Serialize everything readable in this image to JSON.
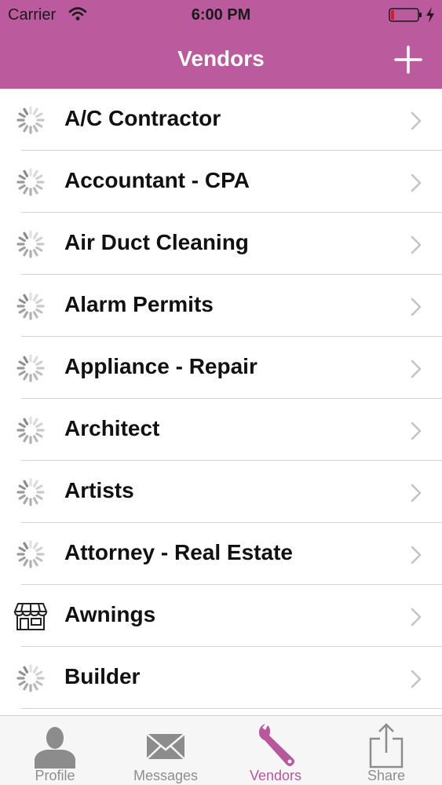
{
  "status": {
    "carrier": "Carrier",
    "time": "6:00 PM",
    "wifi_icon": "wifi-icon",
    "battery_icon": "battery-low-icon",
    "charging_icon": "charging-bolt-icon"
  },
  "navbar": {
    "title": "Vendors",
    "add_icon": "plus-icon"
  },
  "vendors": [
    {
      "label": "A/C Contractor",
      "icon": "loading-spinner-icon"
    },
    {
      "label": "Accountant - CPA",
      "icon": "loading-spinner-icon"
    },
    {
      "label": "Air Duct Cleaning",
      "icon": "loading-spinner-icon"
    },
    {
      "label": "Alarm Permits",
      "icon": "loading-spinner-icon"
    },
    {
      "label": "Appliance - Repair",
      "icon": "loading-spinner-icon"
    },
    {
      "label": "Architect",
      "icon": "loading-spinner-icon"
    },
    {
      "label": "Artists",
      "icon": "loading-spinner-icon"
    },
    {
      "label": "Attorney - Real Estate",
      "icon": "loading-spinner-icon"
    },
    {
      "label": "Awnings",
      "icon": "storefront-icon"
    },
    {
      "label": "Builder",
      "icon": "loading-spinner-icon"
    }
  ],
  "tabs": [
    {
      "label": "Profile",
      "icon": "person-icon",
      "active": false
    },
    {
      "label": "Messages",
      "icon": "envelope-icon",
      "active": false
    },
    {
      "label": "Vendors",
      "icon": "wrench-icon",
      "active": true
    },
    {
      "label": "Share",
      "icon": "share-icon",
      "active": false
    }
  ],
  "colors": {
    "brand": "#bb5b9e",
    "active_tab": "#b8579c",
    "inactive_tab": "#8e8e8e"
  }
}
